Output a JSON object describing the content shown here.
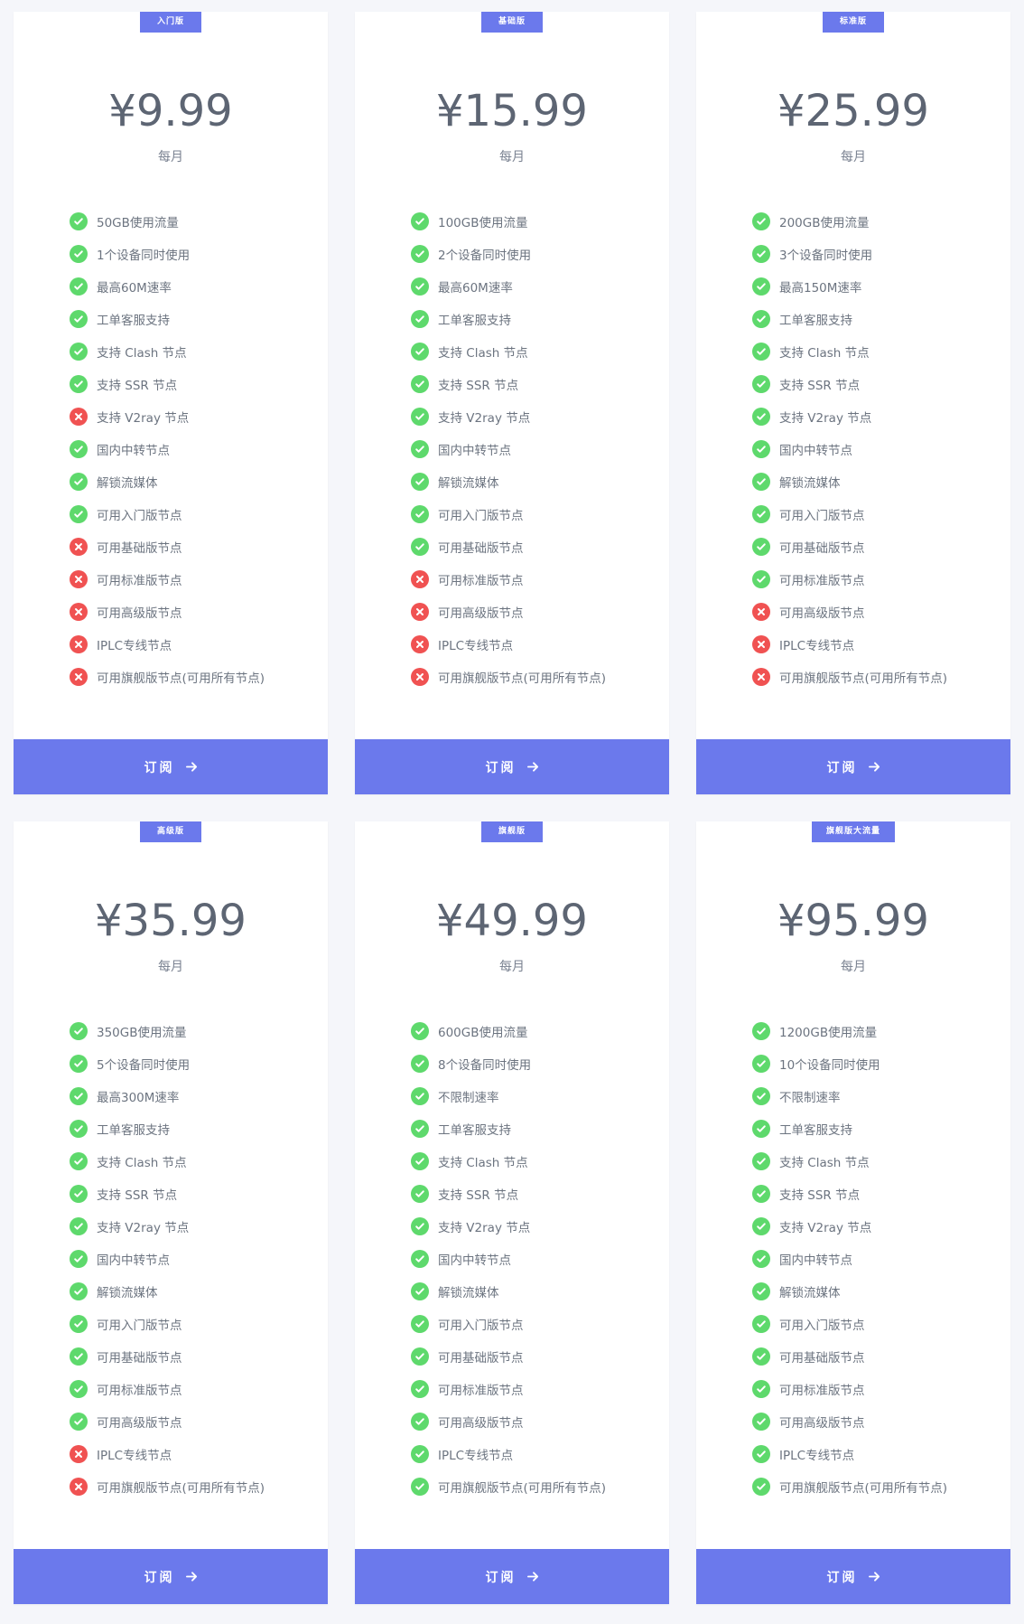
{
  "colors": {
    "page_bg": "#f5f6fa",
    "accent": "#6b79ec",
    "check": "#5ed96c",
    "cross": "#f05252",
    "price_text": "#5d6573"
  },
  "plans": [
    {
      "badge": "入门版",
      "price": "¥9.99",
      "period": "每月",
      "button": "订阅",
      "features": [
        {
          "text": "50GB使用流量",
          "ok": true
        },
        {
          "text": "1个设备同时使用",
          "ok": true
        },
        {
          "text": "最高60M速率",
          "ok": true
        },
        {
          "text": "工单客服支持",
          "ok": true
        },
        {
          "text": "支持 Clash 节点",
          "ok": true
        },
        {
          "text": "支持 SSR 节点",
          "ok": true
        },
        {
          "text": "支持 V2ray 节点",
          "ok": false
        },
        {
          "text": "国内中转节点",
          "ok": true
        },
        {
          "text": "解锁流媒体",
          "ok": true
        },
        {
          "text": "可用入门版节点",
          "ok": true
        },
        {
          "text": "可用基础版节点",
          "ok": false
        },
        {
          "text": "可用标准版节点",
          "ok": false
        },
        {
          "text": "可用高级版节点",
          "ok": false
        },
        {
          "text": "IPLC专线节点",
          "ok": false
        },
        {
          "text": "可用旗舰版节点(可用所有节点)",
          "ok": false
        }
      ]
    },
    {
      "badge": "基础版",
      "price": "¥15.99",
      "period": "每月",
      "button": "订阅",
      "features": [
        {
          "text": "100GB使用流量",
          "ok": true
        },
        {
          "text": "2个设备同时使用",
          "ok": true
        },
        {
          "text": "最高60M速率",
          "ok": true
        },
        {
          "text": "工单客服支持",
          "ok": true
        },
        {
          "text": "支持 Clash 节点",
          "ok": true
        },
        {
          "text": "支持 SSR 节点",
          "ok": true
        },
        {
          "text": "支持 V2ray 节点",
          "ok": true
        },
        {
          "text": "国内中转节点",
          "ok": true
        },
        {
          "text": "解锁流媒体",
          "ok": true
        },
        {
          "text": "可用入门版节点",
          "ok": true
        },
        {
          "text": "可用基础版节点",
          "ok": true
        },
        {
          "text": "可用标准版节点",
          "ok": false
        },
        {
          "text": "可用高级版节点",
          "ok": false
        },
        {
          "text": "IPLC专线节点",
          "ok": false
        },
        {
          "text": "可用旗舰版节点(可用所有节点)",
          "ok": false
        }
      ]
    },
    {
      "badge": "标准版",
      "price": "¥25.99",
      "period": "每月",
      "button": "订阅",
      "features": [
        {
          "text": "200GB使用流量",
          "ok": true
        },
        {
          "text": "3个设备同时使用",
          "ok": true
        },
        {
          "text": "最高150M速率",
          "ok": true
        },
        {
          "text": "工单客服支持",
          "ok": true
        },
        {
          "text": "支持 Clash 节点",
          "ok": true
        },
        {
          "text": "支持 SSR 节点",
          "ok": true
        },
        {
          "text": "支持 V2ray 节点",
          "ok": true
        },
        {
          "text": "国内中转节点",
          "ok": true
        },
        {
          "text": "解锁流媒体",
          "ok": true
        },
        {
          "text": "可用入门版节点",
          "ok": true
        },
        {
          "text": "可用基础版节点",
          "ok": true
        },
        {
          "text": "可用标准版节点",
          "ok": true
        },
        {
          "text": "可用高级版节点",
          "ok": false
        },
        {
          "text": "IPLC专线节点",
          "ok": false
        },
        {
          "text": "可用旗舰版节点(可用所有节点)",
          "ok": false
        }
      ]
    },
    {
      "badge": "高级版",
      "price": "¥35.99",
      "period": "每月",
      "button": "订阅",
      "features": [
        {
          "text": "350GB使用流量",
          "ok": true
        },
        {
          "text": "5个设备同时使用",
          "ok": true
        },
        {
          "text": "最高300M速率",
          "ok": true
        },
        {
          "text": "工单客服支持",
          "ok": true
        },
        {
          "text": "支持 Clash 节点",
          "ok": true
        },
        {
          "text": "支持 SSR 节点",
          "ok": true
        },
        {
          "text": "支持 V2ray 节点",
          "ok": true
        },
        {
          "text": "国内中转节点",
          "ok": true
        },
        {
          "text": "解锁流媒体",
          "ok": true
        },
        {
          "text": "可用入门版节点",
          "ok": true
        },
        {
          "text": "可用基础版节点",
          "ok": true
        },
        {
          "text": "可用标准版节点",
          "ok": true
        },
        {
          "text": "可用高级版节点",
          "ok": true
        },
        {
          "text": "IPLC专线节点",
          "ok": false
        },
        {
          "text": "可用旗舰版节点(可用所有节点)",
          "ok": false
        }
      ]
    },
    {
      "badge": "旗舰版",
      "price": "¥49.99",
      "period": "每月",
      "button": "订阅",
      "features": [
        {
          "text": "600GB使用流量",
          "ok": true
        },
        {
          "text": "8个设备同时使用",
          "ok": true
        },
        {
          "text": "不限制速率",
          "ok": true
        },
        {
          "text": "工单客服支持",
          "ok": true
        },
        {
          "text": "支持 Clash 节点",
          "ok": true
        },
        {
          "text": "支持 SSR 节点",
          "ok": true
        },
        {
          "text": "支持 V2ray 节点",
          "ok": true
        },
        {
          "text": "国内中转节点",
          "ok": true
        },
        {
          "text": "解锁流媒体",
          "ok": true
        },
        {
          "text": "可用入门版节点",
          "ok": true
        },
        {
          "text": "可用基础版节点",
          "ok": true
        },
        {
          "text": "可用标准版节点",
          "ok": true
        },
        {
          "text": "可用高级版节点",
          "ok": true
        },
        {
          "text": "IPLC专线节点",
          "ok": true
        },
        {
          "text": "可用旗舰版节点(可用所有节点)",
          "ok": true
        }
      ]
    },
    {
      "badge": "旗舰版大流量",
      "price": "¥95.99",
      "period": "每月",
      "button": "订阅",
      "features": [
        {
          "text": "1200GB使用流量",
          "ok": true
        },
        {
          "text": "10个设备同时使用",
          "ok": true
        },
        {
          "text": "不限制速率",
          "ok": true
        },
        {
          "text": "工单客服支持",
          "ok": true
        },
        {
          "text": "支持 Clash 节点",
          "ok": true
        },
        {
          "text": "支持 SSR 节点",
          "ok": true
        },
        {
          "text": "支持 V2ray 节点",
          "ok": true
        },
        {
          "text": "国内中转节点",
          "ok": true
        },
        {
          "text": "解锁流媒体",
          "ok": true
        },
        {
          "text": "可用入门版节点",
          "ok": true
        },
        {
          "text": "可用基础版节点",
          "ok": true
        },
        {
          "text": "可用标准版节点",
          "ok": true
        },
        {
          "text": "可用高级版节点",
          "ok": true
        },
        {
          "text": "IPLC专线节点",
          "ok": true
        },
        {
          "text": "可用旗舰版节点(可用所有节点)",
          "ok": true
        }
      ]
    }
  ]
}
